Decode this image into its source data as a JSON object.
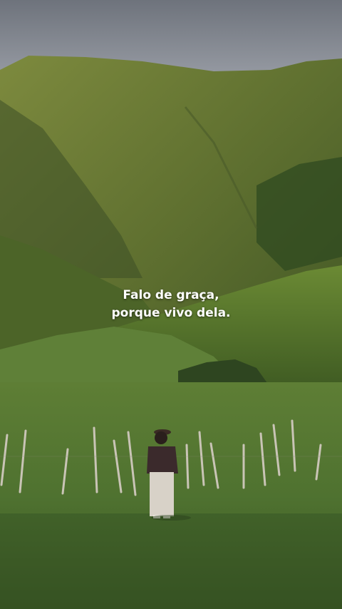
{
  "caption": {
    "line1": "Falo de graça,",
    "line2": "porque vivo dela."
  },
  "colors": {
    "sky": "#8f939c",
    "mountain": "#6f7a3a",
    "grass": "#4f7230",
    "caption_text": "#ffffff"
  }
}
